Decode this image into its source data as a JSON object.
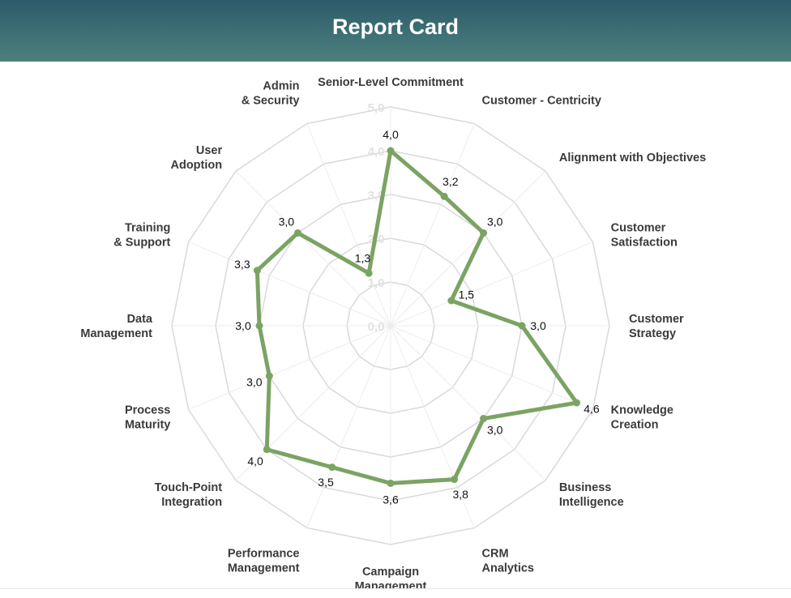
{
  "header": {
    "title": "Report Card"
  },
  "colors": {
    "header_top": "#2d5a6a",
    "header_bottom": "#4d7f7c",
    "series": "#7ba363",
    "grid": "#d9d9d9"
  },
  "chart_data": {
    "type": "radar",
    "categories": [
      "Senior-Level Commitment",
      "Customer - Centricity",
      "Alignment with Objectives",
      "Customer\nSatisfaction",
      "Customer\nStrategy",
      "Knowledge\nCreation",
      "Business\nIntelligence",
      "CRM\nAnalytics",
      "Campaign\nManagement",
      "Performance\nManagement",
      "Touch-Point\nIntegration",
      "Process\nMaturity",
      "Data\nManagement",
      "Training\n& Support",
      "User\nAdoption",
      "Admin\n& Security"
    ],
    "series": [
      {
        "values": [
          4.0,
          3.2,
          3.0,
          1.5,
          3.0,
          4.6,
          3.0,
          3.8,
          3.6,
          3.5,
          4.0,
          3.0,
          3.0,
          3.3,
          3.0,
          1.3
        ]
      }
    ],
    "data_labels": [
      "4,0",
      "3,2",
      "3,0",
      "1,5",
      "3,0",
      "4,6",
      "3,0",
      "3,8",
      "3,6",
      "3,5",
      "4,0",
      "3,0",
      "3,0",
      "3,3",
      "3,0",
      "1,3"
    ],
    "axis": {
      "range": [
        0,
        5
      ],
      "ticks": [
        0,
        1,
        2,
        3,
        4,
        5
      ],
      "tick_labels": [
        "0,0",
        "1,0",
        "2,0",
        "3,0",
        "4,0",
        "5,0"
      ]
    },
    "grid": true,
    "legend": "none"
  }
}
